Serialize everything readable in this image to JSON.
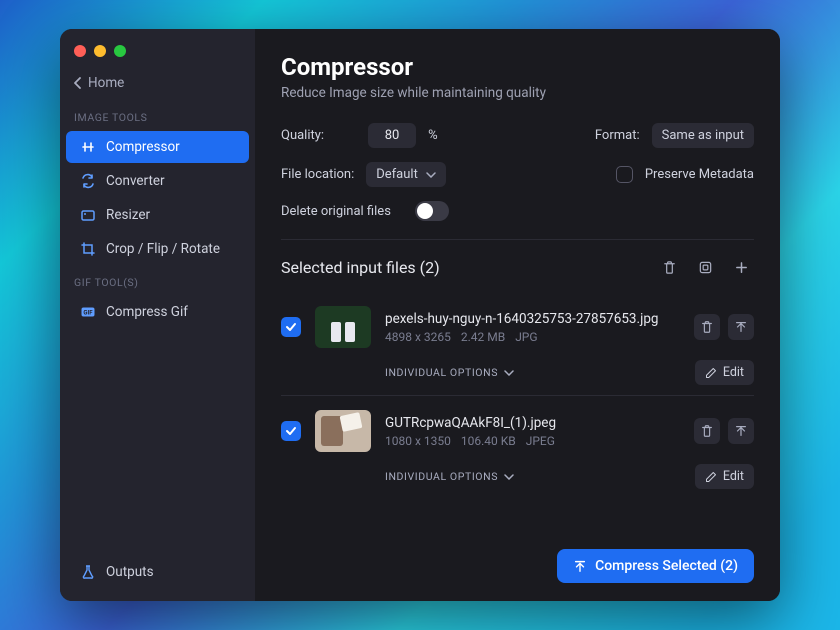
{
  "sidebar": {
    "home_label": "Home",
    "sections": [
      {
        "label": "IMAGE TOOLS",
        "items": [
          {
            "icon": "compress",
            "label": "Compressor",
            "active": true
          },
          {
            "icon": "convert",
            "label": "Converter"
          },
          {
            "icon": "resize",
            "label": "Resizer"
          },
          {
            "icon": "crop",
            "label": "Crop / Flip / Rotate"
          }
        ]
      },
      {
        "label": "GIF TOOL(S)",
        "items": [
          {
            "icon": "gif",
            "label": "Compress Gif"
          }
        ]
      }
    ],
    "outputs_label": "Outputs"
  },
  "main": {
    "title": "Compressor",
    "subtitle": "Reduce Image size while maintaining quality",
    "quality_label": "Quality:",
    "quality_value": "80",
    "quality_unit": "%",
    "format_label": "Format:",
    "format_value": "Same as input",
    "file_location_label": "File location:",
    "file_location_value": "Default",
    "preserve_metadata_label": "Preserve Metadata",
    "delete_originals_label": "Delete original files",
    "files_header": "Selected input files (2)",
    "individual_options_label": "INDIVIDUAL OPTIONS",
    "edit_label": "Edit",
    "compress_button": "Compress Selected (2)",
    "files": [
      {
        "name": "pexels-huy-nguy-n-1640325753-27857653.jpg",
        "dimensions": "4898 x 3265",
        "size": "2.42 MB",
        "format": "JPG"
      },
      {
        "name": "GUTRcpwaQAAkF8I_(1).jpeg",
        "dimensions": "1080 x 1350",
        "size": "106.40 KB",
        "format": "JPEG"
      }
    ]
  }
}
